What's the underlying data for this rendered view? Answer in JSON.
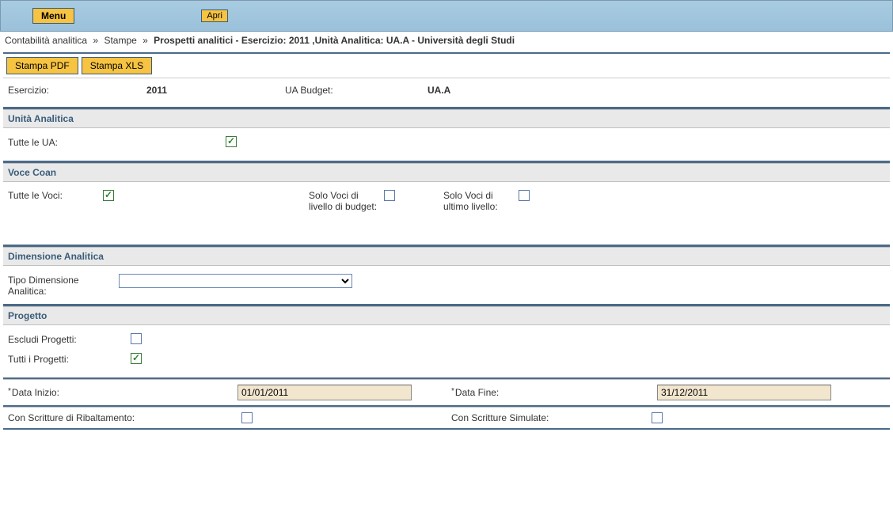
{
  "top": {
    "menu": "Menu",
    "apri": "Apri"
  },
  "breadcrumb": {
    "parts": [
      "Contabilità analitica",
      "Stampe"
    ],
    "sep": "»",
    "current": "Prospetti analitici - Esercizio: 2011 ,Unità Analitica: UA.A - Università degli Studi"
  },
  "toolbar": {
    "stampa_pdf": "Stampa PDF",
    "stampa_xls": "Stampa XLS"
  },
  "info": {
    "esercizio_label": "Esercizio:",
    "esercizio_value": "2011",
    "ua_budget_label": "UA Budget:",
    "ua_budget_value": "UA.A"
  },
  "unita_analitica": {
    "title": "Unità Analitica",
    "tutte_le_ua": "Tutte le UA:"
  },
  "voce_coan": {
    "title": "Voce Coan",
    "tutte_le_voci": "Tutte le Voci:",
    "solo_budget": "Solo Voci di livello di budget:",
    "solo_ultimo": "Solo Voci di ultimo livello:"
  },
  "dimensione": {
    "title": "Dimensione Analitica",
    "tipo_label": "Tipo Dimensione Analitica:"
  },
  "progetto": {
    "title": "Progetto",
    "escludi": "Escludi Progetti:",
    "tutti": "Tutti i Progetti:"
  },
  "dates": {
    "inizio_label": "Data Inizio:",
    "inizio_value": "01/01/2011",
    "fine_label": "Data Fine:",
    "fine_value": "31/12/2011",
    "req": "*"
  },
  "bottom": {
    "ribaltamento": "Con Scritture di Ribaltamento:",
    "simulate": "Con Scritture Simulate:"
  }
}
